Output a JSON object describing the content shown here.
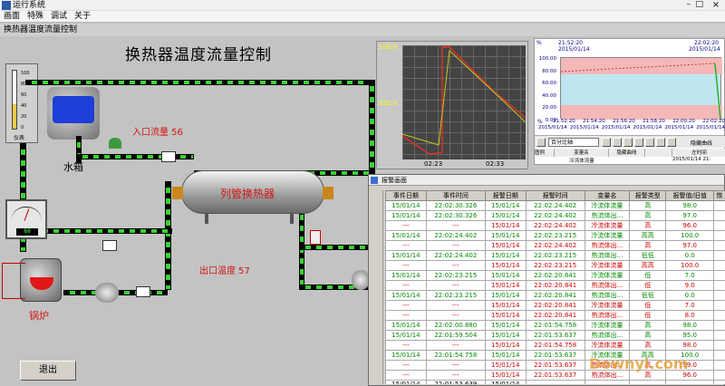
{
  "window": {
    "title": "运行系统",
    "controls": [
      "–",
      "□",
      "×"
    ]
  },
  "menu": [
    "画面",
    "特殊",
    "调试",
    "关于"
  ],
  "screen_name": "换热器温度流量控制",
  "heading": "换热器温度流量控制",
  "labels": {
    "inlet_flow": "入口流量 56",
    "outlet_temp": "出口温度 57",
    "tank": "水箱",
    "boiler": "锅炉",
    "exchanger": "列管换热器",
    "gauge_label": "仪表",
    "exit_button": "退出",
    "meter_digits": "88"
  },
  "gauge_scale": [
    "100",
    "80",
    "60",
    "40",
    "20",
    "0"
  ],
  "trend": {
    "ymax": "100.0",
    "ymid": "050.0",
    "ymin": "0",
    "t1": "02:23",
    "t2": "02:33"
  },
  "right_trend": {
    "y_ticks": [
      "100.00",
      "80.00",
      "60.00",
      "40.00",
      "20.00",
      "0.00"
    ],
    "pct_top": "%",
    "pct_bottom": "%",
    "top_left_time": "21:52:20",
    "top_left_date": "2015/01/14",
    "top_right_time": "22:02:20",
    "top_right_date": "2015/01/14",
    "x_times": [
      "21:52:20",
      "21:54:20",
      "21:56:20",
      "21:58:20",
      "22:00:20",
      "22:02:20"
    ],
    "x_dates": [
      "2015/01/14",
      "2015/01/14",
      "2015/01/14",
      "2015/01/14",
      "2015/01/14",
      "2015/01/14"
    ],
    "combo": "百分比轴",
    "hide_curve": "隐藏曲线",
    "table_headers": [
      "图例",
      "变量名",
      "隐藏曲线",
      "",
      "左时间"
    ],
    "table_row": [
      "",
      "冷流体流量",
      "",
      "",
      "2015/01/14 21:"
    ]
  },
  "alarm": {
    "title": "报警画面",
    "headers": [
      "事件日期",
      "事件时间",
      "报警日期",
      "报警时间",
      "变量名",
      "报警类型",
      "报警值/旧值",
      "恢"
    ],
    "rows": [
      [
        "15/01/14",
        "22:02:30.326",
        "15/01/14",
        "22:02:24.402",
        "冷流体流量",
        "高",
        "98.0"
      ],
      [
        "15/01/14",
        "22:02:30.326",
        "15/01/14",
        "22:02:24.402",
        "热流体出...",
        "高",
        "97.0"
      ],
      [
        "---",
        "---",
        "15/01/14",
        "22:02:24.402",
        "冷流体流量",
        "高",
        "96.0"
      ],
      [
        "15/01/14",
        "22:02:24.402",
        "15/01/14",
        "22:02:23.215",
        "冷流体流量",
        "高高",
        "100.0"
      ],
      [
        "---",
        "---",
        "15/01/14",
        "22:02:24.402",
        "热流体出...",
        "高",
        "97.0"
      ],
      [
        "15/01/14",
        "22:02:24.402",
        "15/01/14",
        "22:02:23.215",
        "热流体出...",
        "低低",
        "0.0"
      ],
      [
        "---",
        "---",
        "15/01/14",
        "22:02:23.215",
        "冷流体流量",
        "高高",
        "100.0"
      ],
      [
        "15/01/14",
        "22:02:23.215",
        "15/01/14",
        "22:02:20.841",
        "冷流体流量",
        "低",
        "7.0"
      ],
      [
        "---",
        "---",
        "15/01/14",
        "22:02:20.841",
        "热流体出...",
        "低",
        "9.0"
      ],
      [
        "15/01/14",
        "22:02:23.215",
        "15/01/14",
        "22:02:20.841",
        "热流体出...",
        "低低",
        "0.0"
      ],
      [
        "---",
        "---",
        "15/01/14",
        "22:02:20.841",
        "冷流体流量",
        "低",
        "7.0"
      ],
      [
        "---",
        "---",
        "15/01/14",
        "22:02:20.841",
        "热流体出...",
        "低",
        "8.0"
      ],
      [
        "15/01/14",
        "22:02:00.880",
        "15/01/14",
        "22:01:54.758",
        "冷流体流量",
        "高",
        "98.0"
      ],
      [
        "15/01/14",
        "22:01:59.504",
        "15/01/14",
        "22:01:53.637",
        "热流体出...",
        "高",
        "95.0"
      ],
      [
        "---",
        "---",
        "15/01/14",
        "22:01:54.758",
        "冷流体流量",
        "高",
        "98.0"
      ],
      [
        "15/01/14",
        "22:01:54.758",
        "15/01/14",
        "22:01:53.637",
        "冷流体流量",
        "高高",
        "100.0"
      ],
      [
        "---",
        "---",
        "15/01/14",
        "22:01:53.637",
        "热流体出...",
        "高",
        "99.0"
      ],
      [
        "---",
        "---",
        "15/01/14",
        "22:01:53.637",
        "热流体出...",
        "高",
        "96.0"
      ],
      [
        "15/01/14",
        "22:01:53.639",
        "15/01/14",
        "",
        "",
        "",
        ""
      ]
    ],
    "row_colors": [
      "green",
      "green",
      "red",
      "green",
      "red",
      "green",
      "red",
      "green",
      "red",
      "green",
      "red",
      "red",
      "green",
      "green",
      "red",
      "green",
      "red",
      "red",
      "black"
    ]
  },
  "watermark": "Downyi.com",
  "colors": {
    "pipe_green": "#3bd135",
    "alarm_red": "#cc0000",
    "alarm_green": "#008800"
  }
}
